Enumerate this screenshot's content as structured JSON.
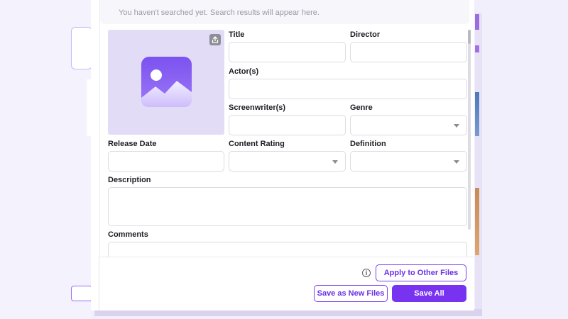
{
  "search": {
    "empty_message": "You haven't searched yet. Search results will appear here."
  },
  "poster": {
    "placeholder_icon": "image-icon",
    "upload_icon": "upload-icon"
  },
  "form": {
    "title_label": "Title",
    "title_value": "",
    "director_label": "Director",
    "director_value": "",
    "actors_label": "Actor(s)",
    "actors_value": "",
    "screenwriters_label": "Screenwriter(s)",
    "screenwriters_value": "",
    "genre_label": "Genre",
    "genre_value": "",
    "release_date_label": "Release Date",
    "release_date_value": "",
    "content_rating_label": "Content Rating",
    "content_rating_value": "",
    "definition_label": "Definition",
    "definition_value": "",
    "description_label": "Description",
    "description_value": "",
    "comments_label": "Comments",
    "comments_value": ""
  },
  "footer": {
    "info_icon": "info-icon",
    "apply_label": "Apply to Other Files",
    "save_new_label": "Save as New Files",
    "save_all_label": "Save All"
  },
  "colors": {
    "accent": "#7833f0",
    "poster_bg": "#e2dcf7",
    "icon_gradient_top": "#7b52f0",
    "icon_gradient_bottom": "#c7b7fb"
  }
}
